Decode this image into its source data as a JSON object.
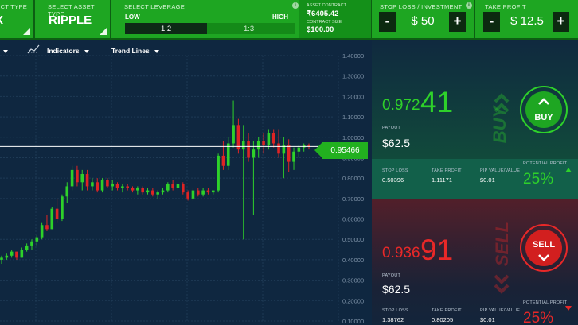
{
  "topbar": {
    "product_type": {
      "caption": "PRODUCT TYPE",
      "value": "X"
    },
    "asset": {
      "caption": "SELECT ASSET TYPE",
      "value": "RIPPLE"
    },
    "leverage": {
      "caption": "SELECT LEVERAGE",
      "low": "LOW",
      "high": "HIGH",
      "options": [
        "1:2",
        "1:3"
      ],
      "selected": "1:2"
    },
    "asset_contract": {
      "caption": "ASSET CONTRACT",
      "value": "₹6405.42",
      "size_caption": "CONTRACT SIZE",
      "size_value": "$100.00"
    },
    "stop_loss": {
      "caption": "STOP LOSS / INVESTMENT",
      "value": "$ 50",
      "minus": "-",
      "plus": "+"
    },
    "take_profit": {
      "caption": "TAKE PROFIT",
      "value": "$ 12.5",
      "minus": "-",
      "plus": "+"
    },
    "info_glyph": "i"
  },
  "chart_toolbar": {
    "indicators": "Indicators",
    "trend_lines": "Trend Lines"
  },
  "chart_data": {
    "type": "candlestick",
    "y_ticks": [
      "1.40000",
      "1.30000",
      "1.20000",
      "1.10000",
      "1.00000",
      "0.90000",
      "0.80000",
      "0.70000",
      "0.60000",
      "0.50000",
      "0.40000",
      "0.30000",
      "0.20000",
      "0.10000"
    ],
    "ylim": [
      0.1,
      1.4
    ],
    "current_price": 0.95466,
    "current_price_label": "0.95466",
    "candles": [
      [
        0.4,
        0.42,
        0.38,
        0.41
      ],
      [
        0.41,
        0.43,
        0.4,
        0.42
      ],
      [
        0.42,
        0.45,
        0.41,
        0.44
      ],
      [
        0.44,
        0.44,
        0.4,
        0.41
      ],
      [
        0.41,
        0.46,
        0.41,
        0.45
      ],
      [
        0.45,
        0.48,
        0.44,
        0.47
      ],
      [
        0.47,
        0.5,
        0.45,
        0.49
      ],
      [
        0.49,
        0.52,
        0.47,
        0.51
      ],
      [
        0.51,
        0.58,
        0.5,
        0.57
      ],
      [
        0.57,
        0.62,
        0.54,
        0.55
      ],
      [
        0.55,
        0.66,
        0.55,
        0.65
      ],
      [
        0.65,
        0.7,
        0.58,
        0.6
      ],
      [
        0.6,
        0.72,
        0.59,
        0.71
      ],
      [
        0.71,
        0.78,
        0.68,
        0.76
      ],
      [
        0.76,
        0.86,
        0.74,
        0.84
      ],
      [
        0.84,
        0.86,
        0.76,
        0.78
      ],
      [
        0.78,
        0.84,
        0.74,
        0.82
      ],
      [
        0.82,
        0.84,
        0.74,
        0.76
      ],
      [
        0.76,
        0.8,
        0.74,
        0.78
      ],
      [
        0.78,
        0.8,
        0.73,
        0.74
      ],
      [
        0.74,
        0.8,
        0.73,
        0.79
      ],
      [
        0.79,
        0.8,
        0.75,
        0.76
      ],
      [
        0.76,
        0.79,
        0.74,
        0.77
      ],
      [
        0.77,
        0.78,
        0.74,
        0.75
      ],
      [
        0.75,
        0.77,
        0.73,
        0.76
      ],
      [
        0.76,
        0.77,
        0.74,
        0.75
      ],
      [
        0.75,
        0.76,
        0.73,
        0.74
      ],
      [
        0.74,
        0.76,
        0.72,
        0.75
      ],
      [
        0.75,
        0.76,
        0.72,
        0.73
      ],
      [
        0.73,
        0.75,
        0.72,
        0.74
      ],
      [
        0.74,
        0.75,
        0.71,
        0.72
      ],
      [
        0.72,
        0.74,
        0.7,
        0.73
      ],
      [
        0.73,
        0.75,
        0.72,
        0.74
      ],
      [
        0.74,
        0.78,
        0.73,
        0.77
      ],
      [
        0.77,
        0.79,
        0.74,
        0.75
      ],
      [
        0.75,
        0.78,
        0.74,
        0.77
      ],
      [
        0.77,
        0.78,
        0.72,
        0.73
      ],
      [
        0.73,
        0.74,
        0.69,
        0.7
      ],
      [
        0.7,
        0.75,
        0.69,
        0.74
      ],
      [
        0.74,
        0.75,
        0.71,
        0.72
      ],
      [
        0.72,
        0.75,
        0.71,
        0.74
      ],
      [
        0.74,
        0.75,
        0.72,
        0.73
      ],
      [
        0.73,
        0.74,
        0.72,
        0.74
      ],
      [
        0.74,
        0.92,
        0.73,
        0.91
      ],
      [
        0.91,
        0.98,
        0.84,
        0.86
      ],
      [
        0.86,
        1.0,
        0.84,
        0.97
      ],
      [
        0.97,
        1.18,
        0.95,
        1.06
      ],
      [
        1.06,
        1.09,
        0.92,
        0.94
      ],
      [
        0.94,
        1.06,
        0.5,
        0.98
      ],
      [
        0.98,
        1.02,
        0.88,
        0.9
      ],
      [
        0.9,
        0.98,
        0.62,
        0.94
      ],
      [
        0.94,
        1.0,
        0.9,
        0.98
      ],
      [
        0.98,
        1.02,
        0.92,
        0.96
      ],
      [
        0.96,
        1.04,
        0.94,
        1.02
      ],
      [
        1.02,
        1.04,
        0.95,
        0.97
      ],
      [
        0.97,
        1.04,
        0.9,
        0.92
      ],
      [
        0.92,
        1.0,
        0.8,
        0.96
      ],
      [
        0.96,
        0.99,
        0.83,
        0.88
      ],
      [
        0.88,
        0.95,
        0.84,
        0.93
      ],
      [
        0.93,
        0.96,
        0.9,
        0.95
      ],
      [
        0.95,
        0.97,
        0.93,
        0.96
      ],
      [
        0.96,
        0.97,
        0.94,
        0.955
      ]
    ],
    "up_color": "#2ed12a",
    "down_color": "#e02424"
  },
  "buy": {
    "price_prefix": "0.972",
    "price_suffix": "41",
    "payout_label": "PAYOUT",
    "payout": "$62.5",
    "word": "BUY",
    "button_label": "BUY",
    "stop_loss_label": "STOP LOSS",
    "stop_loss": "0.50396",
    "take_profit_label": "TAKE PROFIT",
    "take_profit": "1.11171",
    "pip_label": "PIP VALUE/VALUE",
    "pip": "$0.01",
    "potential_label": "POTENTIAL PROFIT",
    "potential": "25%",
    "color": "#2ed12a"
  },
  "sell": {
    "price_prefix": "0.936",
    "price_suffix": "91",
    "payout_label": "PAYOUT",
    "payout": "$62.5",
    "word": "SELL",
    "button_label": "SELL",
    "stop_loss_label": "STOP LOSS",
    "stop_loss": "1.38762",
    "take_profit_label": "TAKE PROFIT",
    "take_profit": "0.80205",
    "pip_label": "PIP VALUE/VALUE",
    "pip": "$0.01",
    "potential_label": "POTENTIAL PROFIT",
    "potential": "25%",
    "color": "#e82828"
  }
}
